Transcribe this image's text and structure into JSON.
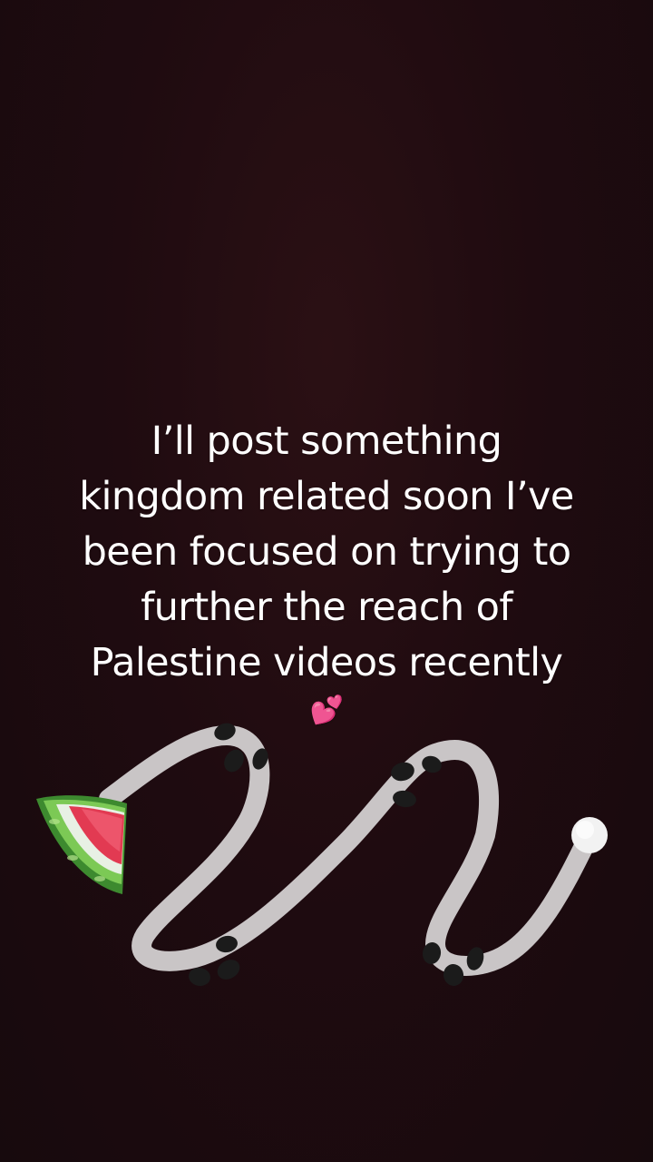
{
  "caption": {
    "lines": [
      "I’ll post something",
      "kingdom related soon I’ve",
      "been focused on trying to",
      "further the reach of",
      "Palestine videos recently"
    ],
    "emoji": "💕"
  },
  "sticker": {
    "icon": "watermelon-path-icon",
    "colors": {
      "path": "#c9c5c6",
      "seed": "#1b1b1b",
      "rind_green": "#5fb84a",
      "flesh_red": "#e23a52",
      "endpoint": "#f2f2f2"
    }
  },
  "colors": {
    "background": "#1f0b10",
    "text": "#ffffff"
  }
}
